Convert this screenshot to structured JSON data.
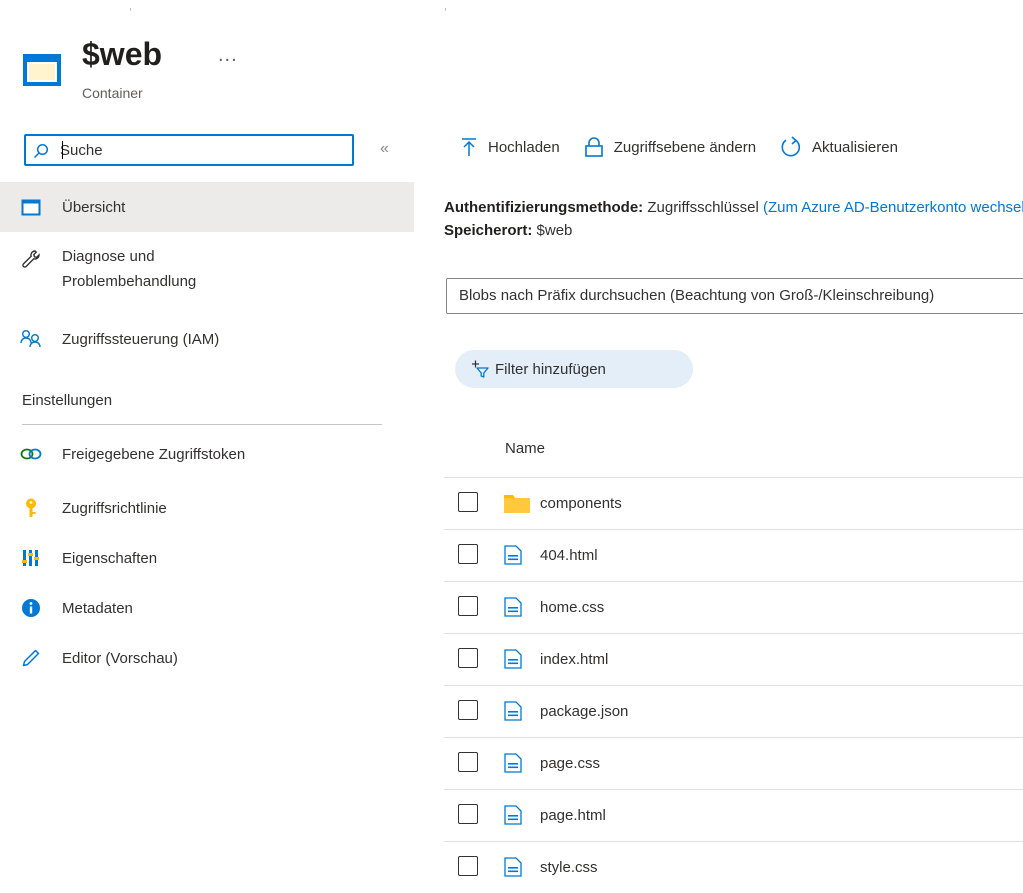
{
  "header": {
    "title": "$web",
    "subtitle": "Container",
    "more": "..."
  },
  "sidebar": {
    "search_placeholder": "Suche",
    "collapse": "«",
    "items": [
      {
        "label": "Übersicht",
        "icon": "container-icon",
        "active": true
      },
      {
        "label": "Diagnose und\nProblembehandlung",
        "icon": "wrench-icon"
      },
      {
        "label": "Zugriffssteuerung (IAM)",
        "icon": "people-icon"
      }
    ],
    "section_label": "Einstellungen",
    "settings_items": [
      {
        "label": "Freigegebene Zugriffstoken",
        "icon": "link-icon"
      },
      {
        "label": "Zugriffsrichtlinie",
        "icon": "key-icon"
      },
      {
        "label": "Eigenschaften",
        "icon": "properties-icon"
      },
      {
        "label": "Metadaten",
        "icon": "info-icon"
      },
      {
        "label": "Editor (Vorschau)",
        "icon": "pencil-icon"
      }
    ]
  },
  "toolbar": {
    "upload": "Hochladen",
    "change_access": "Zugriffsebene ändern",
    "refresh": "Aktualisieren"
  },
  "info": {
    "auth_label": "Authentifizierungsmethode:",
    "auth_value": "Zugriffsschlüssel",
    "auth_link": "(Zum Azure AD-Benutzerkonto wechseln)",
    "location_label": "Speicherort:",
    "location_value": "$web"
  },
  "search": {
    "prefix_placeholder": "Blobs nach Präfix durchsuchen (Beachtung von Groß-/Kleinschreibung)"
  },
  "filter": {
    "label": "Filter hinzufügen"
  },
  "table": {
    "column_name": "Name",
    "rows": [
      {
        "name": "components",
        "type": "folder"
      },
      {
        "name": "404.html",
        "type": "file"
      },
      {
        "name": "home.css",
        "type": "file"
      },
      {
        "name": "index.html",
        "type": "file"
      },
      {
        "name": "package.json",
        "type": "file"
      },
      {
        "name": "page.css",
        "type": "file"
      },
      {
        "name": "page.html",
        "type": "file"
      },
      {
        "name": "style.css",
        "type": "file"
      }
    ]
  },
  "colors": {
    "accent": "#0078d4",
    "folder": "#ffb900",
    "active_bg": "#edebe9",
    "filter_bg": "#e3eef9"
  }
}
